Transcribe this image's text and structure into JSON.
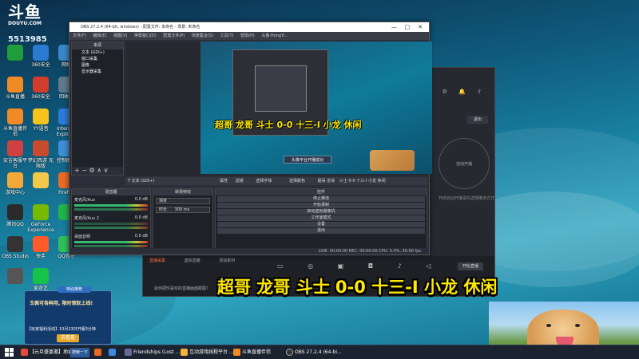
{
  "desktop": {
    "logo_text": "斗鱼",
    "logo_sub": "DOUYU.COM",
    "room_number": "5513985",
    "icons": [
      {
        "label": "",
        "color": "#1f9c3c"
      },
      {
        "label": "360安全",
        "color": "#2a7ad0"
      },
      {
        "label": "网络",
        "color": "#3a86c8"
      },
      {
        "label": "斗鱼直播",
        "color": "#f08a24"
      },
      {
        "label": "360安全",
        "color": "#d23c2c"
      },
      {
        "label": "回收站",
        "color": "#5f7a8c"
      },
      {
        "label": "斗鱼直播伴侣",
        "color": "#f08a24"
      },
      {
        "label": "YY语音",
        "color": "#f6c21c"
      },
      {
        "label": "Internet Explorer",
        "color": "#2d7ad8"
      },
      {
        "label": "安吉客服平台",
        "color": "#d04040"
      },
      {
        "label": "梦幻西游 无限版",
        "color": "#c84b2e"
      },
      {
        "label": "控制面板",
        "color": "#3f8ed6"
      },
      {
        "label": "游戏中心",
        "color": "#f2a93a"
      },
      {
        "label": "",
        "color": "#f2c84a"
      },
      {
        "label": "Firefox",
        "color": "#e86a24"
      },
      {
        "label": "腾讯QQ",
        "color": "#2a2a2a"
      },
      {
        "label": "GeForce Experience",
        "color": "#76b900"
      },
      {
        "label": "",
        "color": "#20b34a"
      },
      {
        "label": "OBS Studio",
        "color": "#333"
      },
      {
        "label": "快手",
        "color": "#ff5a2a"
      },
      {
        "label": "QQ音乐",
        "color": "#2fbf5a"
      },
      {
        "label": "",
        "color": "#555"
      },
      {
        "label": "爱奇艺",
        "color": "#17c24a"
      }
    ]
  },
  "obs": {
    "title": "OBS 27.2.4 (64-bit, windows) - 配置文件: 未命名 - 场景: 未命名",
    "menu": [
      "文件(F)",
      "编辑(E)",
      "视图(V)",
      "停靠窗口(D)",
      "配置文件(P)",
      "场景集合(S)",
      "工具(T)",
      "帮助(H)",
      "头像·HongYi..."
    ],
    "scenes_header": "来源",
    "sources": [
      "文本 (GDI+)",
      "窗口采集",
      "图像",
      "显示器采集"
    ],
    "preview_caption": "超哥 龙哥 斗士 0-0 十三-I 小龙 休闲",
    "preview_button": "头像平台开播成功",
    "source_toolbar": "文本 (GDI+)",
    "props_bar": [
      "属性",
      "滤镜",
      "选择字体",
      "选择颜色",
      "超哥 龙哥",
      "斗士 0-0 十三-I 小龙 休闲"
    ],
    "mixer_header": "混音器",
    "mixer_channels": [
      {
        "name": "麦克风/Aux",
        "db": "0.0 dB"
      },
      {
        "name": "麦克风/Aux 2",
        "db": "0.0 dB"
      },
      {
        "name": "桌面音频",
        "db": "0.0 dB"
      }
    ],
    "trans_header": "转场特效",
    "trans_type": "渐变",
    "trans_duration_label": "时长",
    "trans_duration": "300 ms",
    "controls_header": "控件",
    "controls": [
      "停止推流",
      "开始录制",
      "启动虚拟摄像机",
      "工作室模式",
      "设置",
      "退出"
    ],
    "status": "LIVE: 00:00:00   REC: 00:00:00   CPU: 3.4%, 30.00 fps"
  },
  "douyu_app": {
    "circle_label": "自动开播",
    "side_text": "开启自动开播请先选择推流方式",
    "out_button": "退出",
    "tabs": [
      "直播采集",
      "虚拟直播",
      "添加素材"
    ],
    "active_tab": "直播采集",
    "tip": "如何把你喜欢的直播画面截图?",
    "go_live": "开始直播"
  },
  "overlay_caption": "超哥 龙哥 斗士 0-0 十三-I 小龙 休闲",
  "ad": {
    "top_label": "特别推荐",
    "line1": "玉佩可各种用, 限时领取上线!",
    "line2": "【玩家福利活动】10月13日开服3分钟",
    "button": "去看看"
  },
  "taskbar": {
    "items": [
      {
        "label": "【元旦盛宴邀】地址...",
        "color": "#e24a3a"
      },
      {
        "label": "",
        "color": "#2a7ad0"
      },
      {
        "label": "",
        "color": "#e86a24"
      },
      {
        "label": "",
        "color": "#3c8ae0"
      },
      {
        "label": "Friendships (Lost ...",
        "color": "#6a6a9a"
      },
      {
        "label": "互动游戏线程平台 ...",
        "color": "#f2b33a"
      },
      {
        "label": "斗鱼直播伴侣",
        "color": "#f08a24"
      },
      {
        "label": "OBS 27.2.4 (64-bi...",
        "color": "#333"
      }
    ],
    "search_label": "搜索一下"
  }
}
